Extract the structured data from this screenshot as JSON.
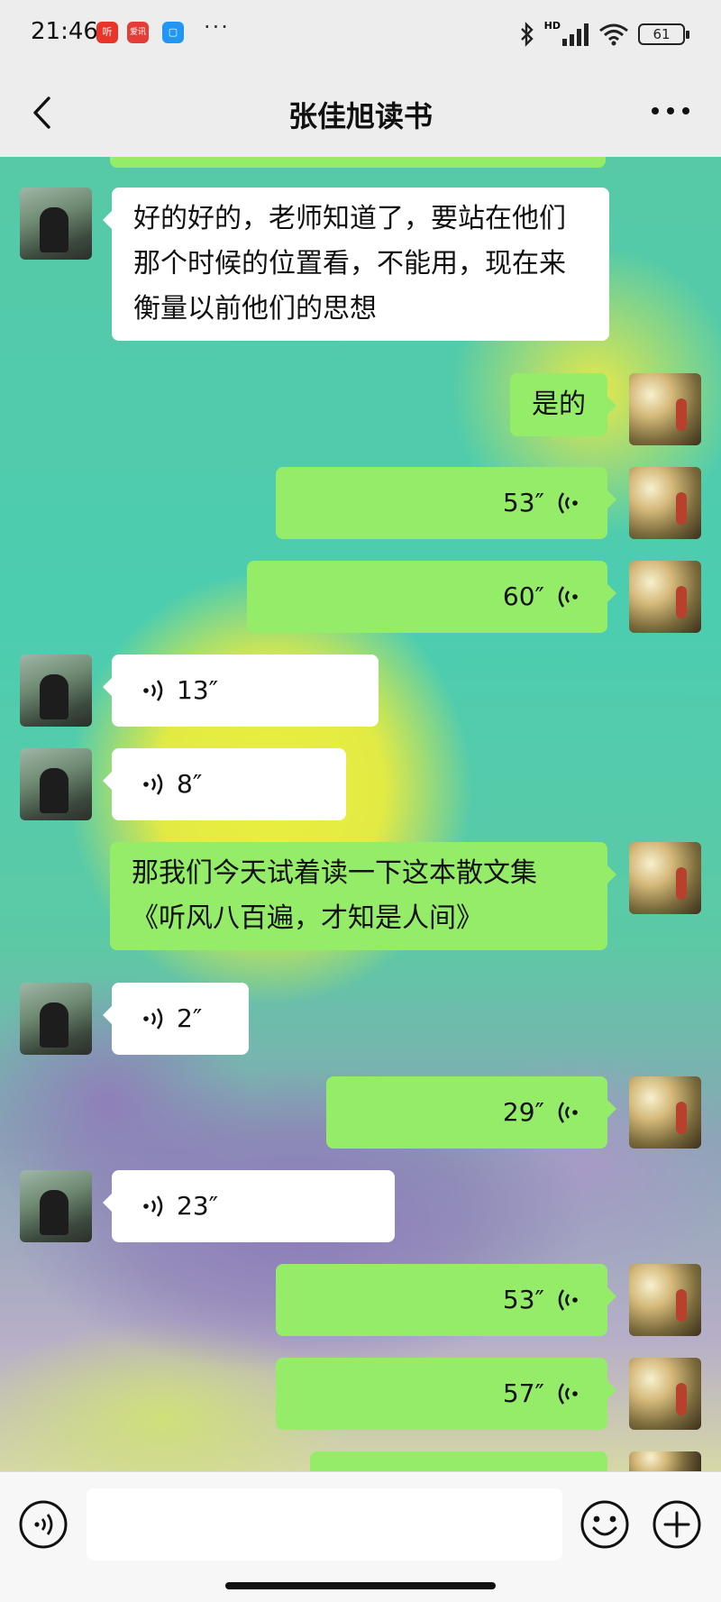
{
  "status_bar": {
    "time": "21:46",
    "app_badges": [
      "听",
      "爱讯"
    ],
    "more": "···",
    "hd_label": "HD",
    "battery": "61"
  },
  "nav": {
    "title": "张佳旭读书",
    "back_icon": "chevron-left-icon",
    "more_icon": "more-icon"
  },
  "messages": [
    {
      "side": "left",
      "type": "text",
      "text": "好的好的，老师知道了，要站在他们那个时候的位置看，不能用，现在来衡量以前他们的思想"
    },
    {
      "side": "right",
      "type": "text",
      "text": "是的"
    },
    {
      "side": "right",
      "type": "voice",
      "duration": "53″"
    },
    {
      "side": "right",
      "type": "voice",
      "duration": "60″"
    },
    {
      "side": "left",
      "type": "voice",
      "duration": "13″"
    },
    {
      "side": "left",
      "type": "voice",
      "duration": "8″"
    },
    {
      "side": "right",
      "type": "text",
      "text": "那我们今天试着读一下这本散文集《听风八百遍，才知是人间》"
    },
    {
      "side": "left",
      "type": "voice",
      "duration": "2″"
    },
    {
      "side": "right",
      "type": "voice",
      "duration": "29″"
    },
    {
      "side": "left",
      "type": "voice",
      "duration": "23″"
    },
    {
      "side": "right",
      "type": "voice",
      "duration": "53″"
    },
    {
      "side": "right",
      "type": "voice",
      "duration": "57″"
    }
  ],
  "input_bar": {
    "voice_icon": "voice-mode-icon",
    "input_value": "",
    "emoji_icon": "emoji-icon",
    "plus_icon": "plus-icon"
  },
  "colors": {
    "bubble_green": "#95ec69",
    "bubble_white": "#ffffff",
    "bar_bg": "#ededed"
  }
}
